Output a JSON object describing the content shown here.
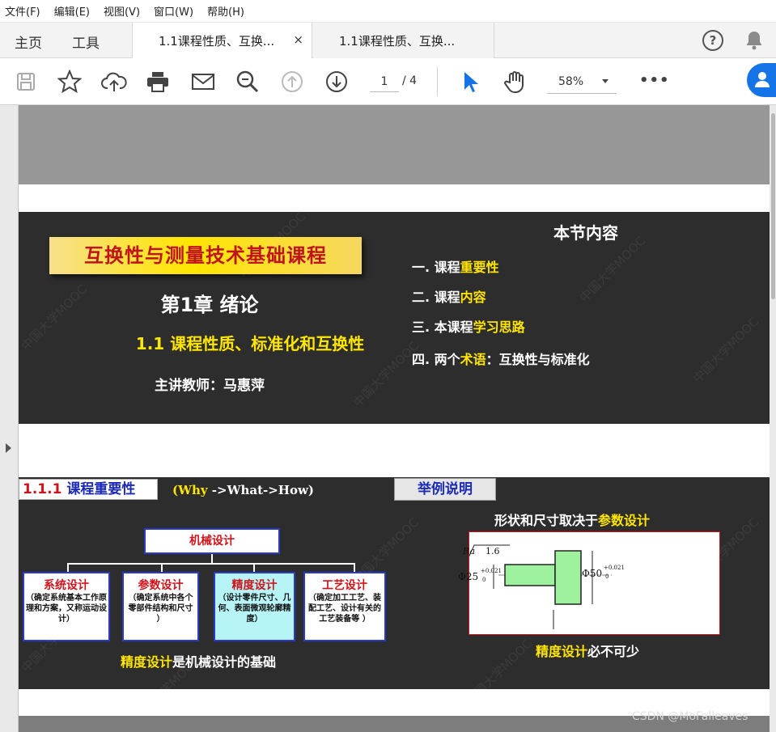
{
  "menu": [
    "文件(F)",
    "编辑(E)",
    "视图(V)",
    "窗口(W)",
    "帮助(H)"
  ],
  "nav": {
    "home": "主页",
    "tools": "工具"
  },
  "tabs": [
    {
      "label": "1.1课程性质、互换...",
      "close": "×"
    },
    {
      "label": "1.1课程性质、互换..."
    }
  ],
  "toolbar": {
    "page_current": "1",
    "page_total": "/ 4",
    "zoom": "58%",
    "more": "•••"
  },
  "slide1": {
    "course_title": "互换性与测量技术基础课程",
    "chapter": "第1章 绪论",
    "section": "1.1 课程性质、标准化和互换性",
    "teacher": "主讲教师：马惠萍",
    "toc_title": "本节内容",
    "toc": [
      {
        "prefix": "一. 课程",
        "highlight": "重要性",
        "suffix": ""
      },
      {
        "prefix": "二. 课程",
        "highlight": "内容",
        "suffix": ""
      },
      {
        "prefix": "三. 本课程",
        "highlight": "学习思路",
        "suffix": ""
      },
      {
        "prefix": "四. 两个",
        "highlight": "术语",
        "suffix": "：互换性与标准化"
      }
    ]
  },
  "slide2": {
    "heading_num": "1.1.1",
    "heading_text": " 课程重要性",
    "why": "(Why",
    "what_how": " ->What->How)",
    "example": "举例说明",
    "root": "机械设计",
    "children": [
      {
        "title": "系统设计",
        "desc": "（确定系统基本工作原理和方案，又称运动设计）"
      },
      {
        "title": "参数设计",
        "desc": "（确定系统中各个零部件结构和尺寸 ）"
      },
      {
        "title": "精度设计",
        "desc": "（设计零件尺寸、几何、表面微观轮廓精度）"
      },
      {
        "title": "工艺设计",
        "desc": "（确定加工工艺、装配工艺、设计有关的工艺装备等 ）"
      }
    ],
    "foot_left_hl": "精度设计",
    "foot_left_rest": "是机械设计的基础",
    "shape_caption_pre": "形状和尺寸取决于",
    "shape_caption_hl": "参数设计",
    "foot_right_hl": "精度设计",
    "foot_right_rest": "必不可少",
    "drawing": {
      "ra_symbol": "Ra",
      "ra_value": "1.6",
      "dim_small": "Φ25",
      "dim_small_tol_upper": "+0.021",
      "dim_small_tol_lower": "0",
      "dim_large": "Φ50",
      "dim_large_tol_upper": "+0.021",
      "dim_large_tol_lower": "0"
    }
  },
  "watermark": "中国大学MOOC",
  "footer_credit": "CSDN @MoFalleaves",
  "colors": {
    "accent_blue": "#1473e6",
    "slide_bg": "#2d2d2d",
    "highlight_yellow": "#ffe600",
    "title_red": "#c0141c"
  }
}
